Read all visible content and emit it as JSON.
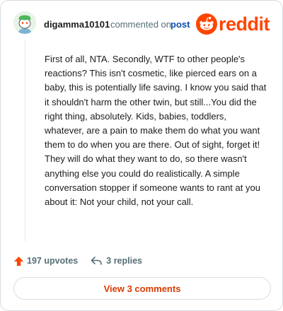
{
  "header": {
    "username": "digamma10101",
    "commented_on": "commented on",
    "post_link": "post",
    "brand": "reddit"
  },
  "comment": {
    "text": "First of all, NTA. Secondly, WTF to other people's reactions? This isn't cosmetic, like pierced ears on a baby, this is potentially life saving. I know you said that it shouldn't harm the other twin, but still...You did the right thing, absolutely. Kids, babies, toddlers, whatever, are a pain to make them do what you want them to do when you are there. Out of sight, forget it! They will do what they want to do, so there wasn't anything else you could do realistically. A simple conversation stopper if someone wants to rant at you about it: Not your child, not your call."
  },
  "actions": {
    "upvotes": "197 upvotes",
    "replies": "3 replies"
  },
  "footer": {
    "view_comments": "View 3 comments"
  },
  "colors": {
    "brand": "#ff4500",
    "link": "#0a4fb0",
    "button_text": "#d93a00"
  }
}
